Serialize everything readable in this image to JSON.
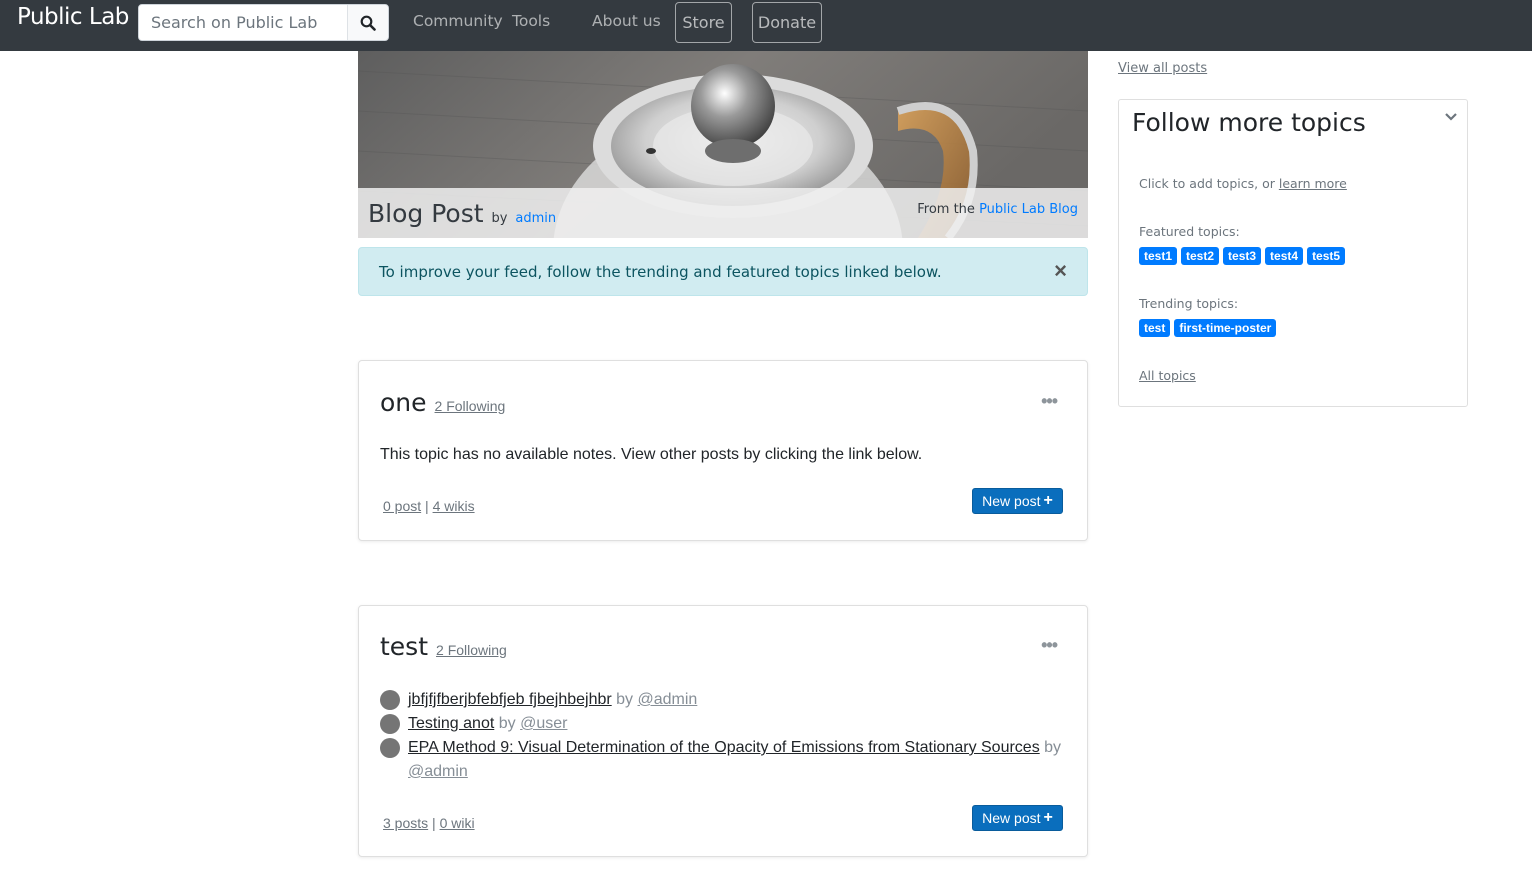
{
  "navbar": {
    "brand": "Public Lab",
    "search_placeholder": "Search on Public Lab",
    "links": [
      "Community",
      "Tools",
      "About us"
    ],
    "store_label": "Store",
    "donate_label": "Donate"
  },
  "hero": {
    "title": "Blog Post",
    "by_label": "by",
    "author": "admin",
    "from_label": "From the",
    "from_link": "Public Lab Blog"
  },
  "alert": {
    "text": "To improve your feed, follow the trending and featured topics linked below.",
    "close": "×"
  },
  "cards": [
    {
      "title": "one",
      "following": "2 Following",
      "body": "This topic has no available notes. View other posts by clicking the link below.",
      "posts_link": "0 post",
      "separator": "|",
      "wikis_link": "4 wikis",
      "new_post": "New post"
    },
    {
      "title": "test",
      "following": "2 Following",
      "notes": [
        {
          "title": "jbfjfjfberjbfebfjeb fjbejhbejhbr",
          "by": "by",
          "author": "@admin"
        },
        {
          "title": "Testing anot",
          "by": "by",
          "author": "@user"
        },
        {
          "title": "EPA Method 9: Visual Determination of the Opacity of Emissions from Stationary Sources",
          "by": "by",
          "author": "@admin"
        }
      ],
      "posts_link": "3 posts",
      "separator": "|",
      "wikis_link": "0 wiki",
      "new_post": "New post"
    }
  ],
  "sidebar": {
    "view_all": "View all posts",
    "title": "Follow more topics",
    "intro": "Click to add topics, or",
    "learn_more": "learn more",
    "featured_label": "Featured topics:",
    "featured": [
      "test1",
      "test2",
      "test3",
      "test4",
      "test5"
    ],
    "trending_label": "Trending topics:",
    "trending": [
      "test",
      "first-time-poster"
    ],
    "all_topics": "All topics"
  }
}
